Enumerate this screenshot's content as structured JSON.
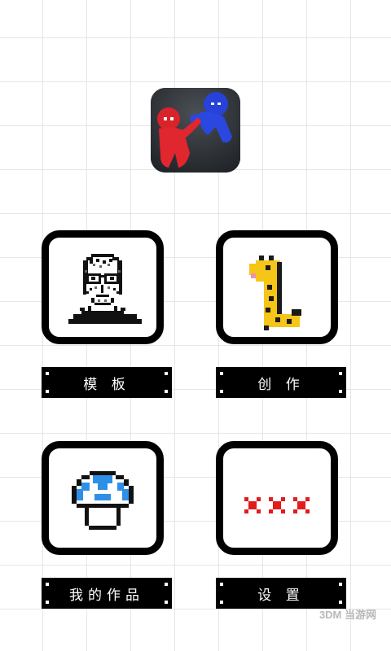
{
  "menu": {
    "templates_label": "模 板",
    "create_label": "创 作",
    "my_works_label": "我的作品",
    "settings_label": "设 置"
  },
  "watermark": {
    "text": "3DM 当游网"
  },
  "icons": {
    "app": "game-app-icon",
    "templates": "pixel-portrait-icon",
    "create": "pixel-giraffe-icon",
    "my_works": "pixel-mushroom-icon",
    "settings": "red-x-pattern-icon"
  },
  "colors": {
    "card_border": "#000000",
    "label_bg": "#000000",
    "label_text": "#ffffff",
    "x_red": "#e21b1b",
    "mushroom_blue": "#2e8fe6",
    "giraffe_yellow": "#f5c518"
  }
}
